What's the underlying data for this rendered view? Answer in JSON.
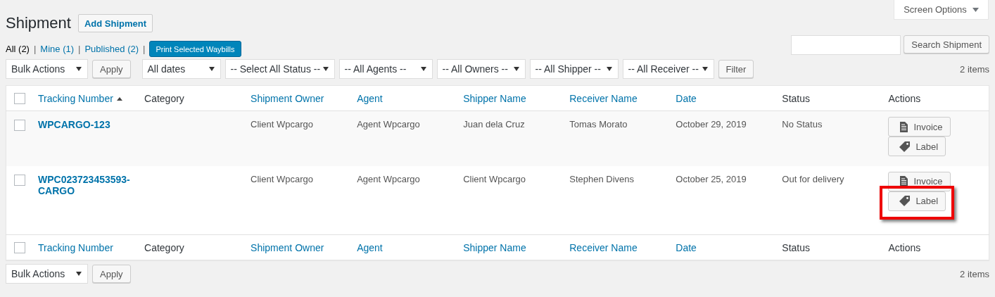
{
  "screen_options": {
    "label": "Screen Options",
    "expanded": false
  },
  "heading": {
    "title": "Shipment",
    "add_button": "Add Shipment"
  },
  "views": [
    {
      "label": "All",
      "count": "(2)",
      "separator": "|",
      "selected": true
    },
    {
      "label": "Mine",
      "count": "(1)",
      "separator": "|",
      "selected": false
    },
    {
      "label": "Published",
      "count": "(2)",
      "separator": "|",
      "selected": false
    }
  ],
  "print_button": "Print Selected Waybills",
  "search": {
    "button": "Search Shipment"
  },
  "top_nav": {
    "bulk_actions": "Bulk Actions",
    "apply": "Apply",
    "filters": [
      "All dates",
      "-- Select All Status --",
      "-- All Agents --",
      "-- All Owners --",
      "-- All Shipper --",
      "-- All Receiver --"
    ],
    "filter_button": "Filter",
    "count": "2 items"
  },
  "table": {
    "header_checkbox": {
      "checked": false
    },
    "columns": [
      {
        "label": "Tracking Number",
        "sortable": true,
        "sorted": true
      },
      {
        "label": "Category",
        "sortable": false,
        "sorted": false
      },
      {
        "label": "Shipment Owner",
        "sortable": true,
        "sorted": false
      },
      {
        "label": "Agent",
        "sortable": true,
        "sorted": false
      },
      {
        "label": "Shipper Name",
        "sortable": true,
        "sorted": false
      },
      {
        "label": "Receiver Name",
        "sortable": true,
        "sorted": false
      },
      {
        "label": "Date",
        "sortable": true,
        "sorted": false
      },
      {
        "label": "Status",
        "sortable": false,
        "sorted": false
      },
      {
        "label": "Actions",
        "sortable": false,
        "sorted": false
      }
    ],
    "footer_checkbox": {
      "checked": false
    },
    "footer_columns": [
      {
        "label": "Tracking Number",
        "sortable": true
      },
      {
        "label": "Category",
        "sortable": false
      },
      {
        "label": "Shipment Owner",
        "sortable": true
      },
      {
        "label": "Agent",
        "sortable": true
      },
      {
        "label": "Shipper Name",
        "sortable": true
      },
      {
        "label": "Receiver Name",
        "sortable": true
      },
      {
        "label": "Date",
        "sortable": true
      },
      {
        "label": "Status",
        "sortable": false
      },
      {
        "label": "Actions",
        "sortable": false
      }
    ],
    "rows": [
      {
        "checked": false,
        "tracking_number": "WPCARGO-123",
        "owner": "Client Wpcargo",
        "agent": "Agent Wpcargo",
        "shipper": "Juan dela Cruz",
        "receiver": "Tomas Morato",
        "date": "October 29, 2019",
        "status": "No Status",
        "actions": [
          {
            "kind": "invoice",
            "label": "Invoice",
            "highlighted": false
          },
          {
            "kind": "label",
            "label": "Label",
            "highlighted": false
          }
        ]
      },
      {
        "checked": false,
        "tracking_number": "WPC023723453593-CARGO",
        "owner": "Client Wpcargo",
        "agent": "Agent Wpcargo",
        "shipper": "Client Wpcargo",
        "receiver": "Stephen Divens",
        "date": "October 25, 2019",
        "status": "Out for delivery",
        "actions": [
          {
            "kind": "invoice",
            "label": "Invoice",
            "highlighted": false
          },
          {
            "kind": "label",
            "label": "Label",
            "highlighted": true
          }
        ]
      }
    ]
  },
  "bottom_nav": {
    "bulk_actions": "Bulk Actions",
    "apply": "Apply",
    "count": "2 items"
  }
}
